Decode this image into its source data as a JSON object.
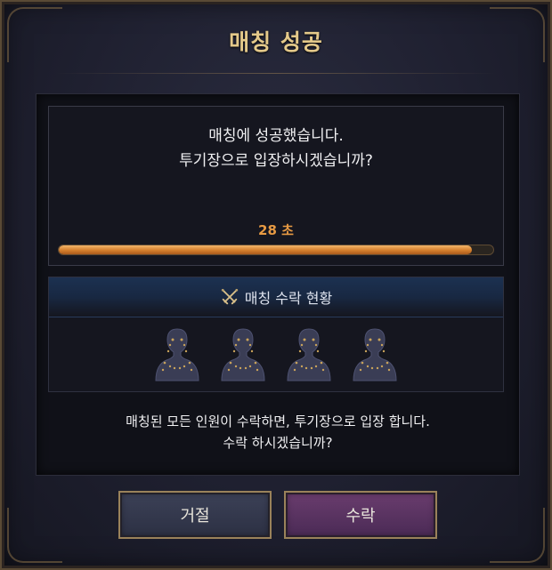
{
  "dialog": {
    "title": "매칭 성공"
  },
  "message": {
    "line1": "매칭에 성공했습니다.",
    "line2": "투기장으로 입장하시겠습니까?"
  },
  "timer": {
    "text": "28 초",
    "progress_fraction": 0.95
  },
  "accept_status": {
    "header_label": "매칭 수락 현황",
    "header_icon": "crossed-swords-icon",
    "players": [
      {
        "icon": "silhouette-icon"
      },
      {
        "icon": "silhouette-icon"
      },
      {
        "icon": "silhouette-icon"
      },
      {
        "icon": "silhouette-icon"
      }
    ]
  },
  "notice": {
    "line1": "매칭된 모든 인원이 수락하면, 투기장으로 입장 합니다.",
    "line2": "수락 하시겠습니까?"
  },
  "buttons": {
    "reject_label": "거절",
    "accept_label": "수락"
  },
  "colors": {
    "title": "#e4c98a",
    "timer": "#e79a43",
    "progress": "#d57f2c",
    "reject_button": "#363a4e",
    "accept_button": "#5a3463"
  }
}
